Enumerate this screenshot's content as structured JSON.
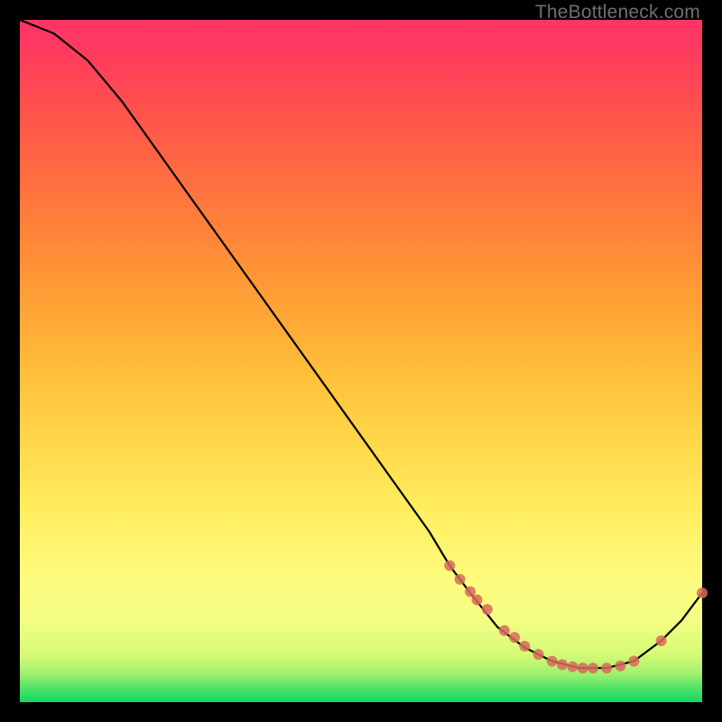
{
  "watermark": "TheBottleneck.com",
  "chart_data": {
    "type": "line",
    "title": "",
    "xlabel": "",
    "ylabel": "",
    "xlim": [
      0,
      100
    ],
    "ylim": [
      0,
      100
    ],
    "series": [
      {
        "name": "bottleneck-curve",
        "x": [
          0,
          5,
          10,
          15,
          20,
          25,
          30,
          35,
          40,
          45,
          50,
          55,
          60,
          63,
          66,
          70,
          74,
          78,
          82,
          86,
          90,
          94,
          97,
          100
        ],
        "y": [
          100,
          98,
          94,
          88,
          81,
          74,
          67,
          60,
          53,
          46,
          39,
          32,
          25,
          20,
          16,
          11,
          8,
          6,
          5,
          5,
          6,
          9,
          12,
          16
        ]
      }
    ],
    "markers": {
      "name": "highlight-points",
      "color": "#d86a5a",
      "x": [
        63,
        64.5,
        66,
        67,
        68.5,
        71,
        72.5,
        74,
        76,
        78,
        79.5,
        81,
        82.5,
        84,
        86,
        88,
        90,
        94,
        100
      ],
      "y": [
        20,
        18,
        16.2,
        15,
        13.6,
        10.5,
        9.5,
        8.2,
        7,
        6,
        5.5,
        5.2,
        5,
        5,
        5,
        5.3,
        6,
        9,
        16
      ]
    }
  }
}
